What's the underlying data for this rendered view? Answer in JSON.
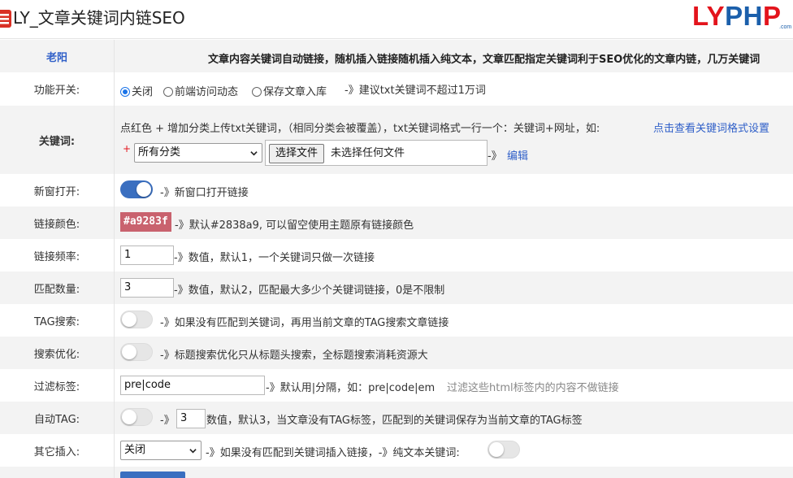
{
  "header": {
    "title": "LY_文章关键词内链SEO",
    "logo_ly": "LY",
    "logo_ph": "PH",
    "logo_p": "P",
    "logo_com": ".com"
  },
  "intro": {
    "label": "老阳",
    "text": "文章内容关键词自动链接，随机插入链接随机插入纯文本，文章匹配指定关键词利于SEO优化的文章内链，几万关键词"
  },
  "function_switch": {
    "label": "功能开关:",
    "options": [
      "关闭",
      "前端访问动态",
      "保存文章入库"
    ],
    "selected": "关闭",
    "hint": "-》建议txt关键词不超过1万词"
  },
  "keywords": {
    "label": "关键词:",
    "desc": "点红色 + 增加分类上传txt关键词，（相同分类会被覆盖），txt关键词格式一行一个：关键词+网址，如:",
    "format_link": "点击查看关键词格式设置",
    "plus": "+",
    "category": "所有分类",
    "file_button": "选择文件",
    "file_text": "未选择任何文件",
    "arrow": "-》",
    "edit_link": "编辑"
  },
  "new_window": {
    "label": "新窗打开:",
    "enabled": true,
    "hint": "-》新窗口打开链接"
  },
  "link_color": {
    "label": "链接颜色:",
    "value": "#a9283f",
    "swatch": "#c9626e",
    "hint": "-》默认#2838a9, 可以留空使用主题原有链接颜色"
  },
  "link_frequency": {
    "label": "链接频率:",
    "value": "1",
    "hint": "-》数值，默认1，一个关键词只做一次链接"
  },
  "match_count": {
    "label": "匹配数量:",
    "value": "3",
    "hint": "-》数值，默认2，匹配最大多少个关键词链接，0是不限制"
  },
  "tag_search": {
    "label": "TAG搜索:",
    "enabled": false,
    "hint": "-》如果没有匹配到关键词，再用当前文章的TAG搜索文章链接"
  },
  "search_opt": {
    "label": "搜索优化:",
    "enabled": false,
    "hint": "-》标题搜索优化只从标题头搜索，全标题搜索消耗资源大"
  },
  "filter_tags": {
    "label": "过滤标签:",
    "value": "pre|code",
    "hint": "-》默认用|分隔，如：pre|code|em",
    "hint_gray": "过滤这些html标签内的内容不做链接"
  },
  "auto_tag": {
    "label": "自动TAG:",
    "enabled": false,
    "arrow": "-》",
    "value": "3",
    "hint": "数值，默认3，当文章没有TAG标签，匹配到的关键词保存为当前文章的TAG标签"
  },
  "other_insert": {
    "label": "其它插入:",
    "select": "关闭",
    "hint": "-》如果没有匹配到关键词插入链接，-》纯文本关键词:",
    "plain_enabled": false
  },
  "colors": {
    "accent": "#3a6fc0",
    "link": "#2f5fc8",
    "logo_red": "#e3141c",
    "logo_blue": "#1b5fab"
  }
}
